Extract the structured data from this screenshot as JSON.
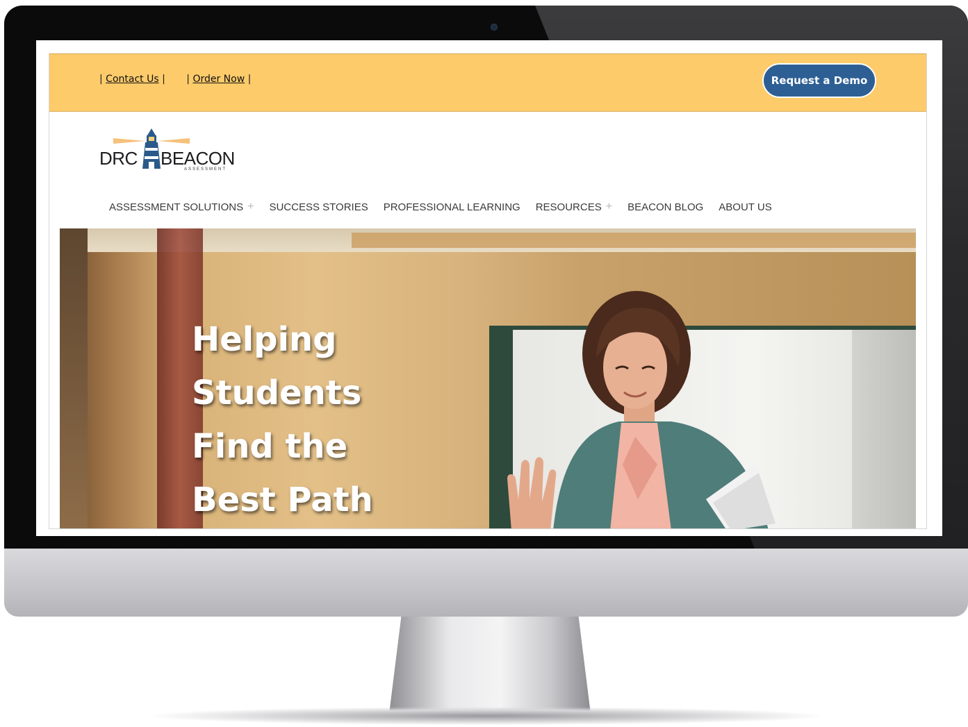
{
  "top_bar": {
    "contact_label": "Contact Us",
    "order_label": "Order Now",
    "demo_button_label": "Request a Demo",
    "colors": {
      "bar": "#fecb6a",
      "button": "#2d5f94"
    }
  },
  "logo": {
    "left_text": "DRC",
    "right_text": "BEACON",
    "subtitle": "ASSESSMENT"
  },
  "nav": {
    "items": [
      {
        "label": "ASSESSMENT SOLUTIONS",
        "has_submenu": true
      },
      {
        "label": "SUCCESS STORIES",
        "has_submenu": false
      },
      {
        "label": "PROFESSIONAL LEARNING",
        "has_submenu": false
      },
      {
        "label": "RESOURCES",
        "has_submenu": true
      },
      {
        "label": "BEACON BLOG",
        "has_submenu": false
      },
      {
        "label": "ABOUT US",
        "has_submenu": false
      }
    ],
    "submenu_icon": "plus-icon"
  },
  "hero": {
    "headline_lines": [
      "Helping",
      "Students",
      "Find the",
      "Best Path"
    ]
  }
}
